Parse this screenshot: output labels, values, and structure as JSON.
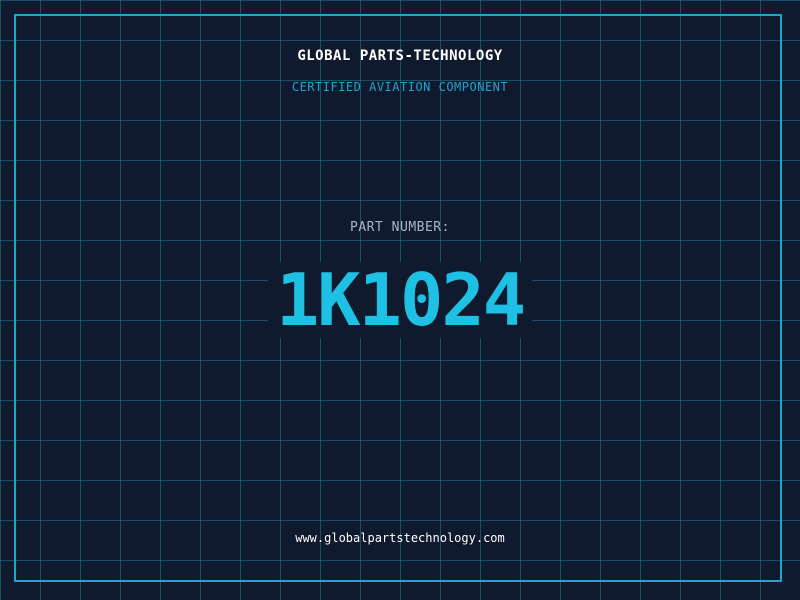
{
  "company_name": "GLOBAL PARTS-TECHNOLOGY",
  "tagline": "CERTIFIED AVIATION COMPONENT",
  "part_label": "PART NUMBER:",
  "part_number": "1K1024",
  "website": "www.globalpartstechnology.com",
  "colors": {
    "background": "#0f1a2e",
    "grid": "#227896",
    "accent": "#1ea5cf",
    "part_number": "#1ec0e3",
    "text_primary": "#ffffff",
    "text_muted": "#a9b6c6"
  }
}
